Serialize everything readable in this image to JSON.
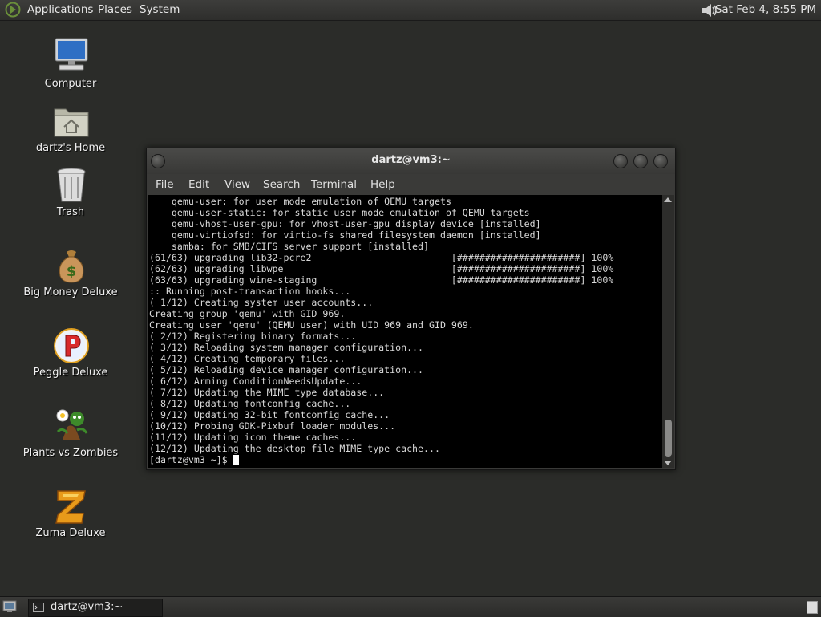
{
  "top_panel": {
    "menus": [
      "Applications",
      "Places",
      "System"
    ],
    "clock": "Sat Feb  4,  8:55 PM"
  },
  "desktop": {
    "icons": [
      {
        "label": "Computer",
        "icon": "computer-icon"
      },
      {
        "label": "dartz's Home",
        "icon": "home-folder-icon"
      },
      {
        "label": "Trash",
        "icon": "trash-icon"
      },
      {
        "label": "Big Money Deluxe",
        "icon": "money-bag-icon"
      },
      {
        "label": "Peggle Deluxe",
        "icon": "peggle-icon"
      },
      {
        "label": "Plants vs Zombies",
        "icon": "plants-vs-zombies-icon"
      },
      {
        "label": "Zuma Deluxe",
        "icon": "zuma-icon"
      }
    ]
  },
  "terminal": {
    "title": "dartz@vm3:~",
    "menu": [
      "File",
      "Edit",
      "View",
      "Search",
      "Terminal",
      "Help"
    ],
    "output": "    qemu-user: for user mode emulation of QEMU targets\n    qemu-user-static: for static user mode emulation of QEMU targets\n    qemu-vhost-user-gpu: for vhost-user-gpu display device [installed]\n    qemu-virtiofsd: for virtio-fs shared filesystem daemon [installed]\n    samba: for SMB/CIFS server support [installed]\n(61/63) upgrading lib32-pcre2                         [######################] 100%\n(62/63) upgrading libwpe                              [######################] 100%\n(63/63) upgrading wine-staging                        [######################] 100%\n:: Running post-transaction hooks...\n( 1/12) Creating system user accounts...\nCreating group 'qemu' with GID 969.\nCreating user 'qemu' (QEMU user) with UID 969 and GID 969.\n( 2/12) Registering binary formats...\n( 3/12) Reloading system manager configuration...\n( 4/12) Creating temporary files...\n( 5/12) Reloading device manager configuration...\n( 6/12) Arming ConditionNeedsUpdate...\n( 7/12) Updating the MIME type database...\n( 8/12) Updating fontconfig cache...\n( 9/12) Updating 32-bit fontconfig cache...\n(10/12) Probing GDK-Pixbuf loader modules...\n(11/12) Updating icon theme caches...\n(12/12) Updating the desktop file MIME type cache...",
    "prompt": "[dartz@vm3 ~]$ "
  },
  "bottom_panel": {
    "task_label": "dartz@vm3:~"
  }
}
